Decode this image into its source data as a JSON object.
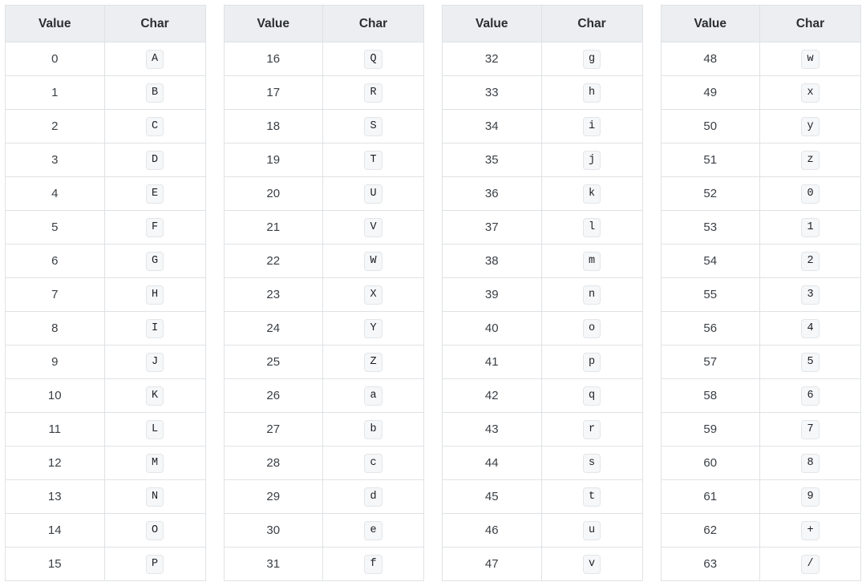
{
  "headers": {
    "value": "Value",
    "char": "Char"
  },
  "chart_data": {
    "type": "table",
    "title": "",
    "columns_per_group": [
      "Value",
      "Char"
    ],
    "groups": [
      [
        {
          "value": 0,
          "char": "A"
        },
        {
          "value": 1,
          "char": "B"
        },
        {
          "value": 2,
          "char": "C"
        },
        {
          "value": 3,
          "char": "D"
        },
        {
          "value": 4,
          "char": "E"
        },
        {
          "value": 5,
          "char": "F"
        },
        {
          "value": 6,
          "char": "G"
        },
        {
          "value": 7,
          "char": "H"
        },
        {
          "value": 8,
          "char": "I"
        },
        {
          "value": 9,
          "char": "J"
        },
        {
          "value": 10,
          "char": "K"
        },
        {
          "value": 11,
          "char": "L"
        },
        {
          "value": 12,
          "char": "M"
        },
        {
          "value": 13,
          "char": "N"
        },
        {
          "value": 14,
          "char": "O"
        },
        {
          "value": 15,
          "char": "P"
        }
      ],
      [
        {
          "value": 16,
          "char": "Q"
        },
        {
          "value": 17,
          "char": "R"
        },
        {
          "value": 18,
          "char": "S"
        },
        {
          "value": 19,
          "char": "T"
        },
        {
          "value": 20,
          "char": "U"
        },
        {
          "value": 21,
          "char": "V"
        },
        {
          "value": 22,
          "char": "W"
        },
        {
          "value": 23,
          "char": "X"
        },
        {
          "value": 24,
          "char": "Y"
        },
        {
          "value": 25,
          "char": "Z"
        },
        {
          "value": 26,
          "char": "a"
        },
        {
          "value": 27,
          "char": "b"
        },
        {
          "value": 28,
          "char": "c"
        },
        {
          "value": 29,
          "char": "d"
        },
        {
          "value": 30,
          "char": "e"
        },
        {
          "value": 31,
          "char": "f"
        }
      ],
      [
        {
          "value": 32,
          "char": "g"
        },
        {
          "value": 33,
          "char": "h"
        },
        {
          "value": 34,
          "char": "i"
        },
        {
          "value": 35,
          "char": "j"
        },
        {
          "value": 36,
          "char": "k"
        },
        {
          "value": 37,
          "char": "l"
        },
        {
          "value": 38,
          "char": "m"
        },
        {
          "value": 39,
          "char": "n"
        },
        {
          "value": 40,
          "char": "o"
        },
        {
          "value": 41,
          "char": "p"
        },
        {
          "value": 42,
          "char": "q"
        },
        {
          "value": 43,
          "char": "r"
        },
        {
          "value": 44,
          "char": "s"
        },
        {
          "value": 45,
          "char": "t"
        },
        {
          "value": 46,
          "char": "u"
        },
        {
          "value": 47,
          "char": "v"
        }
      ],
      [
        {
          "value": 48,
          "char": "w"
        },
        {
          "value": 49,
          "char": "x"
        },
        {
          "value": 50,
          "char": "y"
        },
        {
          "value": 51,
          "char": "z"
        },
        {
          "value": 52,
          "char": "0"
        },
        {
          "value": 53,
          "char": "1"
        },
        {
          "value": 54,
          "char": "2"
        },
        {
          "value": 55,
          "char": "3"
        },
        {
          "value": 56,
          "char": "4"
        },
        {
          "value": 57,
          "char": "5"
        },
        {
          "value": 58,
          "char": "6"
        },
        {
          "value": 59,
          "char": "7"
        },
        {
          "value": 60,
          "char": "8"
        },
        {
          "value": 61,
          "char": "9"
        },
        {
          "value": 62,
          "char": "+"
        },
        {
          "value": 63,
          "char": "/"
        }
      ]
    ]
  }
}
